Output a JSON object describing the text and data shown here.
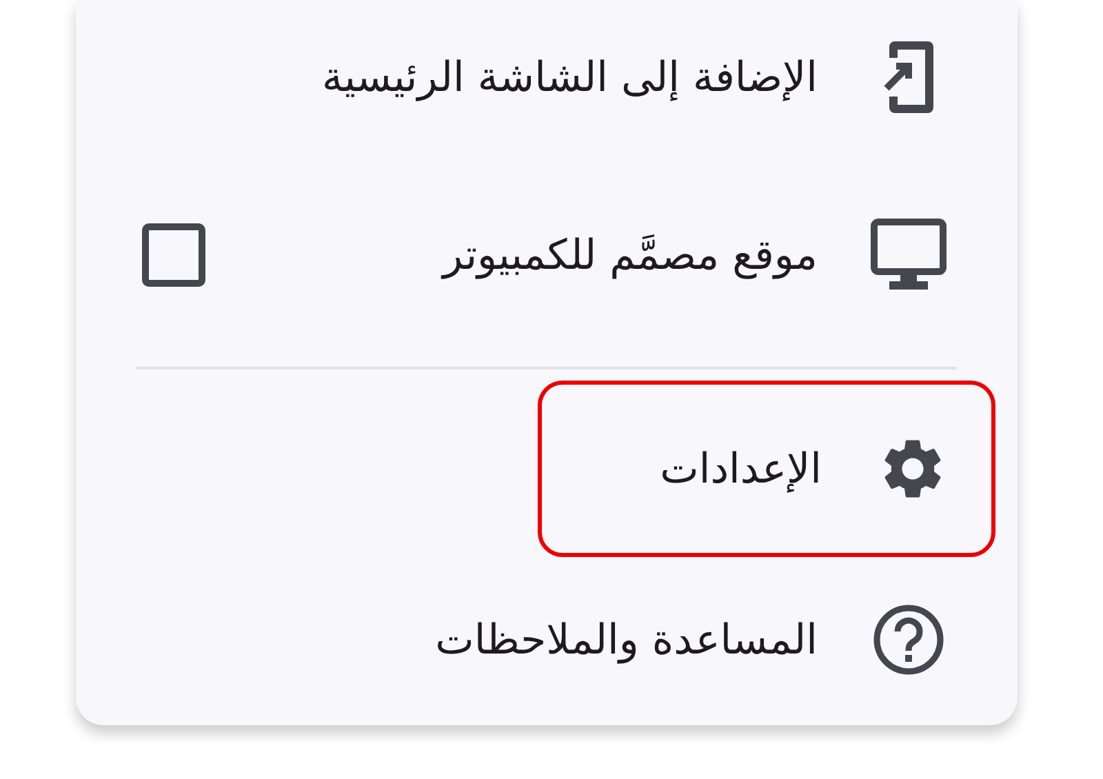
{
  "menu": {
    "items": [
      {
        "kind": "action",
        "label": "الإضافة إلى الشاشة الرئيسية",
        "highlighted": false
      },
      {
        "kind": "checkbox",
        "label": "موقع مصمَّم للكمبيوتر",
        "checked": false,
        "highlighted": false
      },
      {
        "kind": "divider"
      },
      {
        "kind": "action",
        "label": "الإعدادات",
        "highlighted": true
      },
      {
        "kind": "action",
        "label": "المساعدة والملاحظات",
        "highlighted": false
      }
    ]
  }
}
